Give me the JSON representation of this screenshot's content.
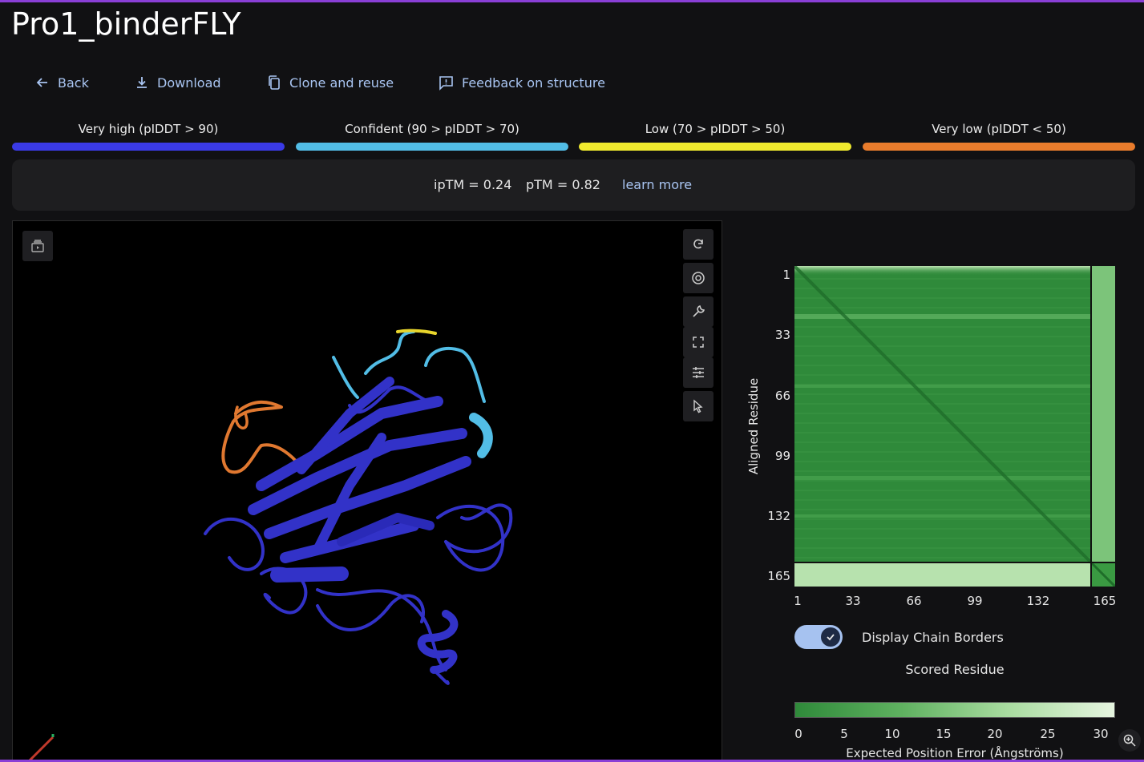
{
  "page": {
    "title": "Pro1_binderFLY"
  },
  "actions": [
    {
      "label": "Back",
      "icon": "arrow-left-icon"
    },
    {
      "label": "Download",
      "icon": "download-icon"
    },
    {
      "label": "Clone and reuse",
      "icon": "copy-icon"
    },
    {
      "label": "Feedback on structure",
      "icon": "feedback-icon"
    }
  ],
  "confidence_legend": [
    {
      "label": "Very high (pIDDT > 90)",
      "color": "#3a3ae6"
    },
    {
      "label": "Confident (90 > pIDDT > 70)",
      "color": "#52bde6"
    },
    {
      "label": "Low (70 > pIDDT > 50)",
      "color": "#f0ea2e"
    },
    {
      "label": "Very low (pIDDT < 50)",
      "color": "#e97c2c"
    }
  ],
  "metrics": {
    "iptm": "ipTM = 0.24",
    "ptm": "pTM = 0.82",
    "learn_more": "learn more"
  },
  "viewer": {
    "toolbar": [
      "rotate-icon",
      "screenshot-icon",
      "wrench-icon",
      "fullscreen-icon",
      "settings-sliders-icon",
      "select-cursor-icon"
    ],
    "corner_button": "animation-icon"
  },
  "pae": {
    "y_ticks": [
      "1",
      "33",
      "66",
      "99",
      "132",
      "165"
    ],
    "x_ticks": [
      "1",
      "33",
      "66",
      "99",
      "132",
      "165"
    ],
    "y_label": "Aligned Residue",
    "x_label": "Scored Residue",
    "toggle_label": "Display Chain Borders",
    "toggle_on": true,
    "colorbar_ticks": [
      "0",
      "5",
      "10",
      "15",
      "20",
      "25",
      "30"
    ],
    "colorbar_label": "Expected Position Error (Ångströms)",
    "colorbar_colors": [
      "#2f8a3a",
      "#e6f5e0"
    ]
  }
}
